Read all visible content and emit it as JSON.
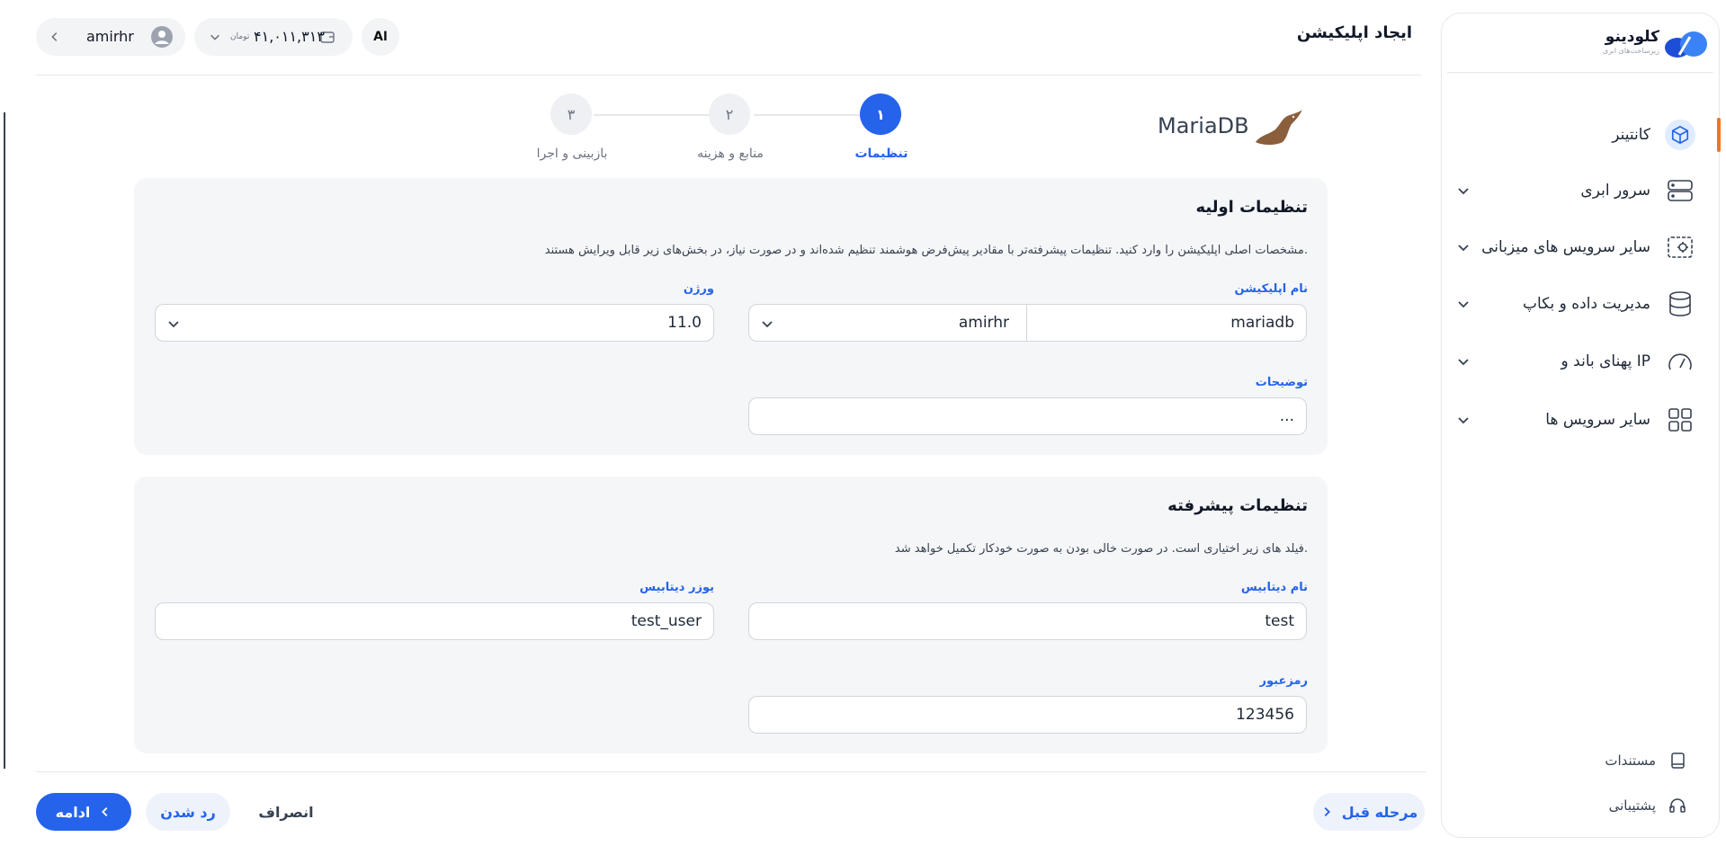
{
  "brand": {
    "name": "کلودینو",
    "tagline": "زیرساخت‌های ابری",
    "accent": "#2563eb"
  },
  "sidebar": {
    "items": [
      {
        "label": "کانتینر",
        "icon": "cube-icon",
        "active": true
      },
      {
        "label": "سرور ابری",
        "icon": "server-icon"
      },
      {
        "label": "سایر سرویس های میزبانی",
        "icon": "server-gear-icon"
      },
      {
        "label": "مدیریت داده و بکاپ",
        "icon": "database-icon"
      },
      {
        "label": "پهنای باند و IP",
        "icon": "gauge-icon"
      },
      {
        "label": "سایر سرویس ها",
        "icon": "grid-icon"
      }
    ],
    "footer": [
      {
        "label": "مستندات",
        "icon": "book-icon"
      },
      {
        "label": "پشتیبانی",
        "icon": "headset-icon"
      }
    ]
  },
  "header": {
    "title": "ایجاد اپلیکیشن",
    "username": "amirhr",
    "balance": "۴۱,۰۱۱,۳۱۳",
    "currency": "تومان",
    "lang_label": "Aا"
  },
  "stepper": {
    "steps": [
      {
        "number": "۱",
        "label": "تنظیمات",
        "active": true
      },
      {
        "number": "۲",
        "label": "منابع و هزینه"
      },
      {
        "number": "۳",
        "label": "بازبینی و اجرا"
      }
    ]
  },
  "app": {
    "name": "MariaDB",
    "icon": "seal-icon"
  },
  "basic": {
    "title": "تنظیمات اولیه",
    "description": "مشخصات اصلی اپلیکیشن را وارد کنید. تنظیمات پیشرفته‌تر با مقادیر پیش‌فرض هوشمند تنظیم شده‌اند و در صورت نیاز، در بخش‌های زیر قابل ویرایش هستند.",
    "app_name_label": "نام اپلیکیشن",
    "app_name_value": "mariadb",
    "app_name_owner": "amirhr",
    "version_label": "ورژن",
    "version_value": "11.0",
    "desc_label": "توضیحات",
    "desc_value": "..."
  },
  "advanced": {
    "title": "تنظیمات پیشرفته",
    "description": "فیلد های زیر اختیاری است. در صورت خالی بودن به صورت خودکار تکمیل خواهد شد.",
    "db_name_label": "نام دیتابیس",
    "db_name_value": "test",
    "db_user_label": "یوزر دیتابیس",
    "db_user_value": "test_user",
    "password_label": "رمزعبور",
    "password_value": "123456"
  },
  "footer": {
    "continue": "ادامه",
    "reject": "رد شدن",
    "cancel": "انصراف",
    "prev": "مرحله قبل"
  }
}
